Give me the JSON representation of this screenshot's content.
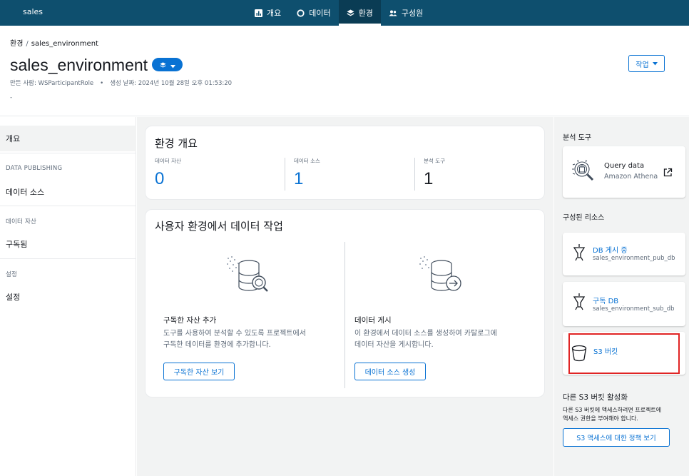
{
  "app": {
    "name": "sales"
  },
  "nav": {
    "items": [
      {
        "label": "개요",
        "icon": "chart-icon"
      },
      {
        "label": "데이터",
        "icon": "circle-icon"
      },
      {
        "label": "환경",
        "icon": "layers-icon",
        "active": true
      },
      {
        "label": "구성원",
        "icon": "users-icon"
      }
    ]
  },
  "header": {
    "breadcrumb": {
      "root": "환경",
      "separator": "/",
      "current": "sales_environment"
    },
    "title": "sales_environment",
    "created_by": "만든 사람: WSParticipantRole",
    "created_at": "생성 날짜: 2024년 10월 28일 오후 01:53:20",
    "description": "-",
    "action_label": "작업"
  },
  "sidebar": {
    "overview": "개요",
    "group_publishing": "DATA PUBLISHING",
    "data_source": "데이터 소스",
    "group_assets": "데이터 자산",
    "subscribed": "구독됨",
    "group_settings": "설정",
    "settings": "설정"
  },
  "overview": {
    "title": "환경 개요",
    "stats": [
      {
        "label": "데이터 자산",
        "value": "0"
      },
      {
        "label": "데이터 소스",
        "value": "1"
      },
      {
        "label": "분석 도구",
        "value": "1"
      }
    ]
  },
  "work": {
    "title": "사용자 환경에서 데이터 작업",
    "left": {
      "title": "구독한 자산 추가",
      "desc_line1": "도구를 사용하여 분석할 수 있도록 프로젝트에서",
      "desc_line2": "구독한 데이터를 환경에 추가합니다.",
      "button": "구독한 자산 보기"
    },
    "right": {
      "title": "데이터 게시",
      "desc_line1": "이 환경에서 데이터 소스를 생성하여 카탈로그에",
      "desc_line2": "데이터 자산을 게시합니다.",
      "button": "데이터 소스 생성"
    }
  },
  "right_panel": {
    "analysis_heading": "분석 도구",
    "query": {
      "title": "Query data",
      "subtitle": "Amazon Athena"
    },
    "resources_heading": "구성된 리소스",
    "resources": [
      {
        "title": "DB 게시 중",
        "subtitle": "sales_environment_pub_db"
      },
      {
        "title": "구독 DB",
        "subtitle": "sales_environment_sub_db"
      },
      {
        "title": "S3 버킷",
        "subtitle": ""
      }
    ],
    "other_s3": {
      "heading": "다른 S3 버킷 활성화",
      "line1": "다른 S3 버킷에 액세스하려면 프로젝트에",
      "line2": "액세스 권한을 부여해야 합니다.",
      "button": "S3 액세스에 대한 정책 보기"
    }
  },
  "colors": {
    "topbar": "#0e4f6e",
    "accent": "#0972d3",
    "stat_blue": "#0972d3",
    "highlight": "#e02424"
  }
}
